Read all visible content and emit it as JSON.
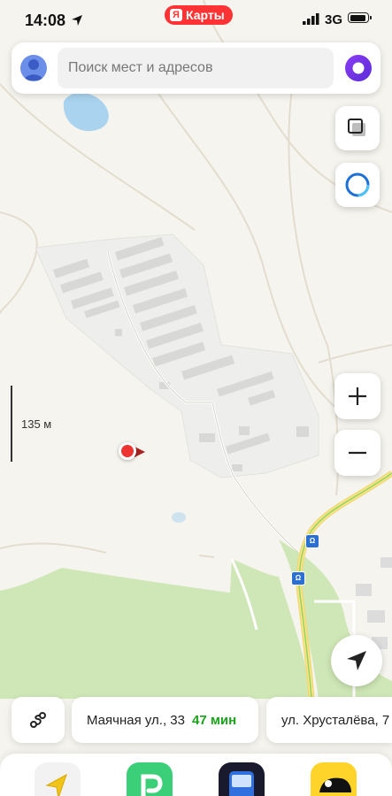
{
  "status_bar": {
    "time": "14:08",
    "app_badge": "Карты",
    "app_badge_logo": "Я",
    "network": "3G"
  },
  "search": {
    "placeholder": "Поиск мест и адресов"
  },
  "map": {
    "scale_label": "135 м",
    "route_badge": "Ω"
  },
  "shortcuts": [
    {
      "label": "Маячная ул., 33",
      "eta": "47 мин"
    },
    {
      "label": "ул. Хрусталёва, 7"
    }
  ],
  "colors": {
    "brand": "#ff3333",
    "eta_green": "#1aa31a",
    "map_bg": "#f6f4ee",
    "forest": "#cfe7b6",
    "road": "#ffe680",
    "water": "#a9d3ee"
  },
  "icons": {
    "layers": "layers-icon",
    "alice_assistant": "alice-icon",
    "zoom_in": "plus-icon",
    "zoom_out": "minus-icon",
    "locate": "navigation-arrow-icon",
    "route_toggle": "route-icon"
  }
}
